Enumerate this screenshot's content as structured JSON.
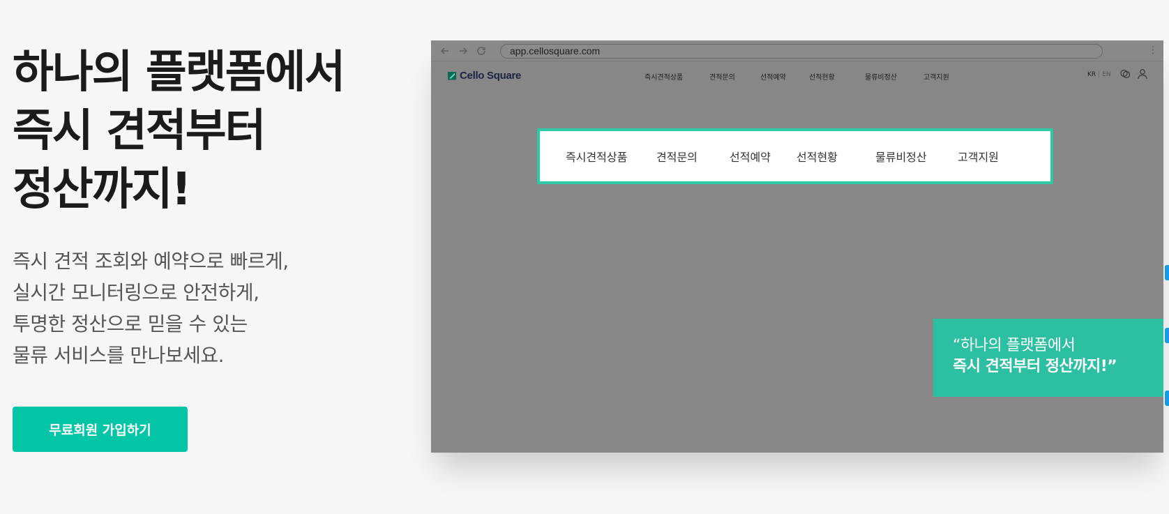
{
  "hero": {
    "title_lines": [
      "하나의 플랫폼에서",
      "즉시 견적부터",
      "정산까지!"
    ],
    "desc_lines": [
      "즉시 견적 조회와 예약으로 빠르게,",
      "실시간 모니터링으로 안전하게,",
      "투명한 정산으로 믿을 수 있는",
      "물류 서비스를 만나보세요."
    ],
    "cta_label": "무료회원 가입하기"
  },
  "browser": {
    "url": "app.cellosquare.com",
    "logo_text": "Cello Square",
    "nav_items": [
      "즉시견적상품",
      "견적문의",
      "선적예약",
      "선적현황",
      "물류비정산",
      "고객지원"
    ],
    "lang_active": "KR",
    "lang_inactive": "EN",
    "panel_items": [
      "즉시견적상품",
      "견적문의",
      "선적예약",
      "선적현황",
      "물류비정산",
      "고객지원"
    ],
    "quote_line1": "“하나의 플랫폼에서",
    "quote_line2": "즉시 견적부터 정산까지!”"
  },
  "colors": {
    "accent": "#04c5a6",
    "highlight_border": "#2fc7a6",
    "quote_bg": "#2cbfa1",
    "overlay": "#888888"
  },
  "icons": [
    "back-arrow-icon",
    "forward-arrow-icon",
    "reload-icon",
    "more-vertical-icon",
    "chat-icon",
    "user-icon"
  ]
}
